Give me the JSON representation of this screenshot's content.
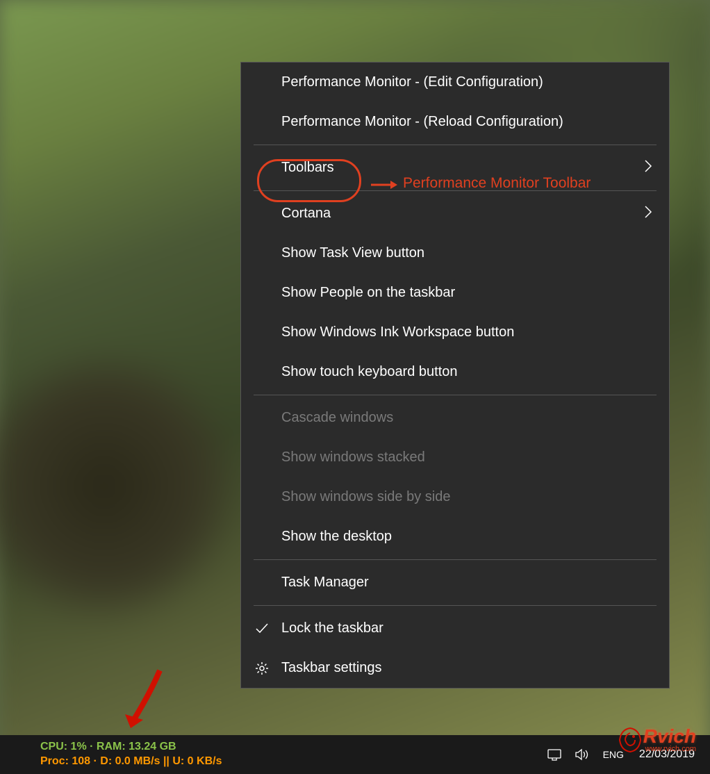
{
  "menu": {
    "items": [
      {
        "label": "Performance Monitor - (Edit Configuration)",
        "enabled": true
      },
      {
        "label": "Performance Monitor - (Reload Configuration)",
        "enabled": true
      }
    ],
    "group2": [
      {
        "label": "Toolbars",
        "submenu": true,
        "enabled": true
      }
    ],
    "group3": [
      {
        "label": "Cortana",
        "submenu": true,
        "enabled": true
      },
      {
        "label": "Show Task View button",
        "enabled": true
      },
      {
        "label": "Show People on the taskbar",
        "enabled": true
      },
      {
        "label": "Show Windows Ink Workspace button",
        "enabled": true
      },
      {
        "label": "Show touch keyboard button",
        "enabled": true
      }
    ],
    "group4": [
      {
        "label": "Cascade windows",
        "enabled": false
      },
      {
        "label": "Show windows stacked",
        "enabled": false
      },
      {
        "label": "Show windows side by side",
        "enabled": false
      },
      {
        "label": "Show the desktop",
        "enabled": true
      }
    ],
    "group5": [
      {
        "label": "Task Manager",
        "enabled": true
      }
    ],
    "group6": [
      {
        "label": "Lock the taskbar",
        "icon": "checkmark",
        "enabled": true
      },
      {
        "label": "Taskbar settings",
        "icon": "gear",
        "enabled": true
      }
    ]
  },
  "annotation": {
    "text": "Performance Monitor Toolbar"
  },
  "taskbar": {
    "perf_line1": "CPU: 1% · RAM: 13.24 GB",
    "perf_line2": "Proc: 108 · D: 0.0 MB/s || U: 0 KB/s",
    "lang": "ENG",
    "date": "22/03/2019"
  },
  "watermark": {
    "title": "Rvich",
    "sub": "www.rvich.com"
  }
}
